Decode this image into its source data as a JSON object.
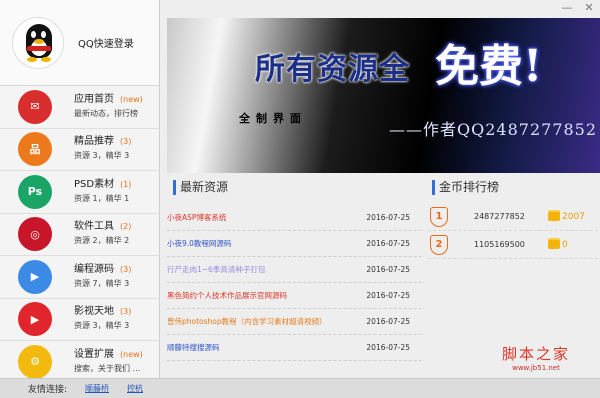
{
  "window": {
    "minimize": "—",
    "close": "✕"
  },
  "login": {
    "label": "QQ快速登录"
  },
  "nav": [
    {
      "title": "应用首页",
      "badge": "(new)",
      "sub": "最新动态，排行榜",
      "color": "#d92e2e",
      "icon": "mail-icon",
      "glyph": "✉"
    },
    {
      "title": "精品推荐",
      "badge": "(3)",
      "sub_a": "资源 3",
      "sub_b": "精华 3",
      "color": "#ec7a1c",
      "icon": "network-icon",
      "glyph": "品"
    },
    {
      "title": "PSD素材",
      "badge": "(1)",
      "sub_a": "资源 1",
      "sub_b": "精华 1",
      "color": "#1aa566",
      "icon": "photoshop-icon",
      "glyph": "Ps"
    },
    {
      "title": "软件工具",
      "badge": "(2)",
      "sub_a": "资源 2",
      "sub_b": "精华 2",
      "color": "#c8152a",
      "icon": "creative-cloud-icon",
      "glyph": "◎"
    },
    {
      "title": "编程源码",
      "badge": "(3)",
      "sub_a": "资源 7",
      "sub_b": "精华 3",
      "color": "#3a8ae6",
      "icon": "video-chat-icon",
      "glyph": "▶"
    },
    {
      "title": "影视天地",
      "badge": "(3)",
      "sub_a": "资源 3",
      "sub_b": "精华 3",
      "color": "#e0262c",
      "icon": "youtube-icon",
      "glyph": "▶"
    },
    {
      "title": "设置扩展",
      "badge": "(new)",
      "sub": "搜索，关于我们 ...",
      "color": "#f2b90f",
      "icon": "settings-gear-icon",
      "glyph": "⚙"
    }
  ],
  "banner": {
    "headline": "所有资源全",
    "free": "免费!",
    "left_text": "全制界面",
    "author": "——作者QQ2487277852"
  },
  "latest": {
    "title": "最新资源",
    "items": [
      {
        "title": "小夜ASP博客系统",
        "date": "2016-07-25",
        "color": "#e0362a"
      },
      {
        "title": "小夜9.0教程网源码",
        "date": "2016-07-25",
        "color": "#2f55c8"
      },
      {
        "title": "行尸走肉1~6季高清种子打包",
        "date": "2016-07-25",
        "color": "#9a8ae0"
      },
      {
        "title": "黑色简约个人技术作品展示官网源码",
        "date": "2016-07-25",
        "color": "#e0362a"
      },
      {
        "title": "曾伟photoshop教程（内含学习素材超清视频）",
        "date": "2016-07-25",
        "color": "#e87a1a"
      },
      {
        "title": "顺藤特搜搜源码",
        "date": "2016-07-25",
        "color": "#2f55c8"
      }
    ]
  },
  "ranking": {
    "title": "金币排行榜",
    "rows": [
      {
        "rank": "1",
        "qq": "2487277852",
        "coins": "2007"
      },
      {
        "rank": "2",
        "qq": "1105169500",
        "coins": "0"
      }
    ]
  },
  "watermark": {
    "main": "脚本之家",
    "url": "www.jb51.net"
  },
  "footer": {
    "label": "友情连接:",
    "links": [
      "顺藤桥",
      "控杭"
    ]
  }
}
